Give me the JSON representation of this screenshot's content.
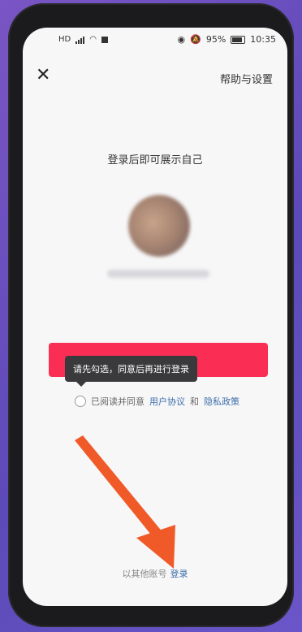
{
  "status_bar": {
    "left_label": "HD",
    "battery": "95%",
    "time": "10:35"
  },
  "header": {
    "close_glyph": "✕",
    "help_label": "帮助与设置"
  },
  "main": {
    "title": "登录后即可展示自己",
    "tooltip": "请先勾选，同意后再进行登录",
    "agreement_prefix": "已阅读并同意",
    "user_agreement": "用户协议",
    "and": "和",
    "privacy_policy": "隐私政策"
  },
  "footer": {
    "other_account_prefix": "以其他账号",
    "login_link": "登录"
  },
  "colors": {
    "accent": "#fa2d55",
    "link": "#3d6ea8",
    "annotation_arrow": "#f05a28"
  }
}
